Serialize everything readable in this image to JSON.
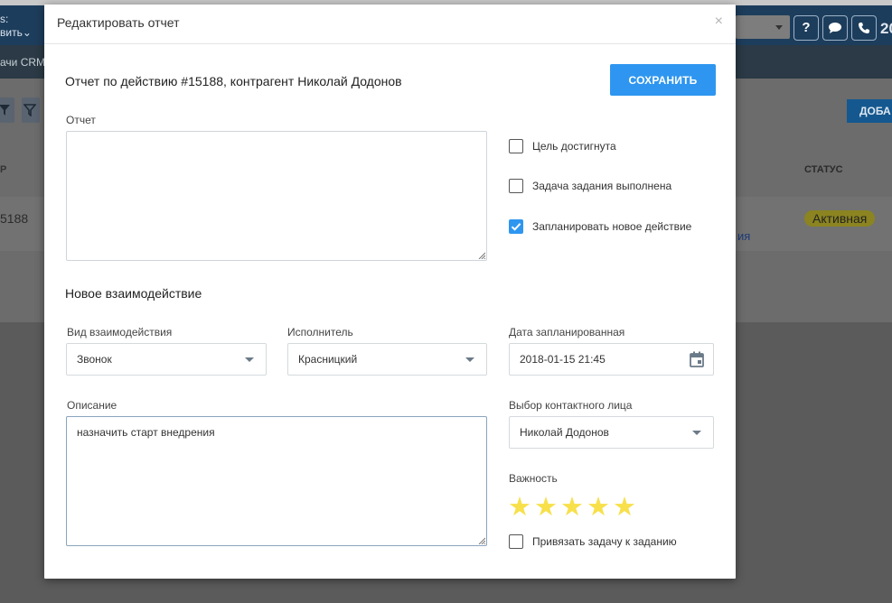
{
  "background": {
    "header_left_top": "s:",
    "header_left_bottom": "вить",
    "nav_fragment": "ачи CRM",
    "help_label": "?",
    "header_number": "20",
    "add_button_fragment": "ДОБА",
    "status_column_header": "СТАТУС",
    "row_number_fragment": "5188",
    "status_badge": "Активная",
    "link_fragment": "ия",
    "column_header_fragment": "Р"
  },
  "modal": {
    "title": "Редактировать отчет",
    "close_label": "×",
    "report_heading": "Отчет по действию #15188, контрагент Николай Додонов",
    "save_label": "СОХРАНИТЬ",
    "report_label": "Отчет",
    "report_value": "",
    "checkboxes": [
      {
        "label": "Цель достигнута",
        "checked": false
      },
      {
        "label": "Задача задания выполнена",
        "checked": false
      },
      {
        "label": "Запланировать новое действие",
        "checked": true
      }
    ],
    "new_interaction_title": "Новое взаимодействие",
    "interaction_type": {
      "label": "Вид взаимодействия",
      "value": "Звонок"
    },
    "executor": {
      "label": "Исполнитель",
      "value": "Красницкий"
    },
    "planned_date": {
      "label": "Дата запланированная",
      "value": "2018-01-15 21:45"
    },
    "description": {
      "label": "Описание",
      "value": "назначить старт внедрения"
    },
    "contact": {
      "label": "Выбор контактного лица",
      "value": "Николай Додонов"
    },
    "importance": {
      "label": "Важность",
      "rating": 5,
      "max": 5
    },
    "link_task": {
      "label": "Привязать задачу к заданию",
      "checked": false
    }
  },
  "colors": {
    "primary": "#2e96f0",
    "star": "#f7e04a",
    "header_bg": "#1d3d5c"
  }
}
